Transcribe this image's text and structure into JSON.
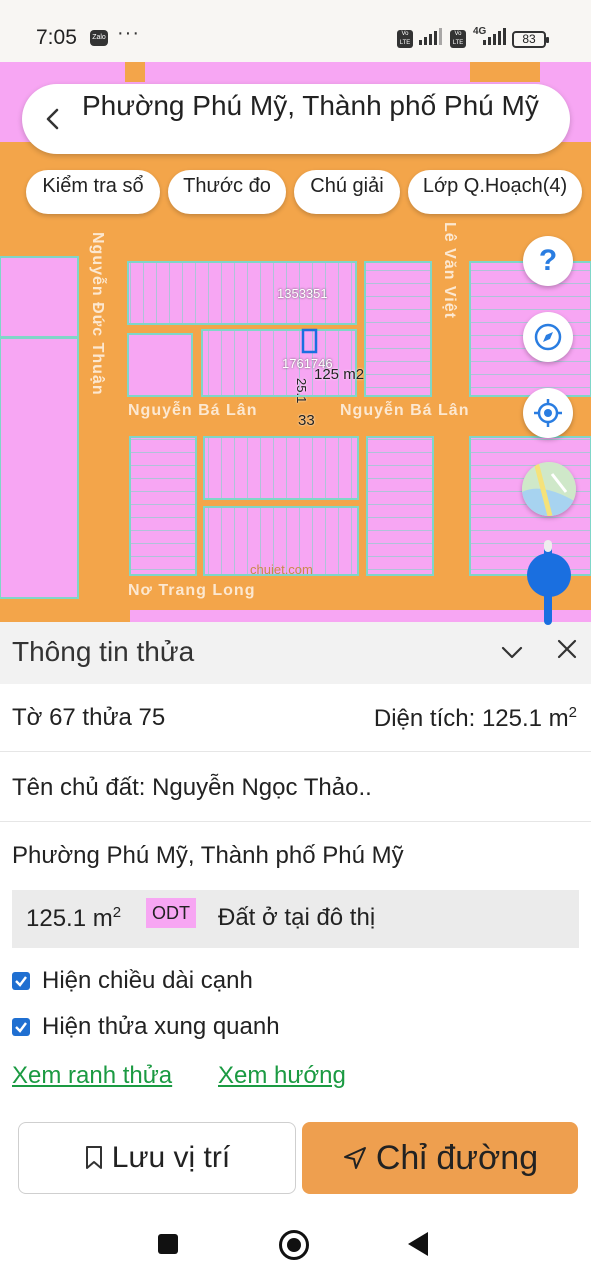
{
  "status_bar": {
    "time": "7:05",
    "notification_app": "Zalo",
    "more": "···",
    "volte_label": "Vo LTE",
    "network": "4G",
    "battery": "83"
  },
  "map": {
    "location_title": "Phường Phú Mỹ, Thành phố Phú Mỹ",
    "chips": [
      {
        "label": "Kiểm tra sổ"
      },
      {
        "label": "Thước đo"
      },
      {
        "label": "Chú giải"
      },
      {
        "label": "Lớp Q.Hoạch(4)"
      }
    ],
    "roads": {
      "vertical_left": "Nguyễn Đức Thuận",
      "vertical_right": "Lê Văn Việt",
      "horizontal_mid_left": "Nguyễn Bá Lân",
      "horizontal_mid_right": "Nguyễn Bá Lân",
      "horizontal_bottom": "Nơ Trang Long"
    },
    "labels": {
      "parcel_top": "1353351",
      "parcel_selected": "1761746",
      "parcel_area": "125 m2",
      "edge_vertical": "25.1",
      "edge_bottom": "33",
      "watermark": "chuiet.com"
    },
    "controls": {
      "help": "?",
      "compass": "compass-icon",
      "locate": "target-icon",
      "layers": "layers-icon"
    },
    "colors": {
      "road": "#f3a54a",
      "parcel": "#f7a6f3",
      "parcel_line": "#7fd6c8",
      "accent_blue": "#1a6fe0"
    }
  },
  "panel": {
    "title": "Thông tin thửa",
    "sheet_parcel": "Tờ 67 thửa 75",
    "area_label": "Diện tích: 125.1 m",
    "area_sup": "2",
    "owner": "Tên chủ đất: Nguyễn Ngọc Thảo..",
    "address": "Phường Phú Mỹ, Thành phố Phú Mỹ",
    "land_area": "125.1 m",
    "land_area_sup": "2",
    "land_code": "ODT",
    "land_desc": "Đất ở tại đô thị",
    "checkboxes": [
      {
        "label": "Hiện chiều dài cạnh",
        "checked": true
      },
      {
        "label": "Hiện thửa xung quanh",
        "checked": true
      }
    ],
    "links": {
      "boundary": "Xem ranh thửa",
      "direction": "Xem hướng"
    },
    "buttons": {
      "save": "Lưu vị trí",
      "directions": "Chỉ đường"
    },
    "colors": {
      "go_button": "#ee9f4f",
      "link": "#1b9a42",
      "land_code_bg": "#f7a6f3"
    }
  }
}
